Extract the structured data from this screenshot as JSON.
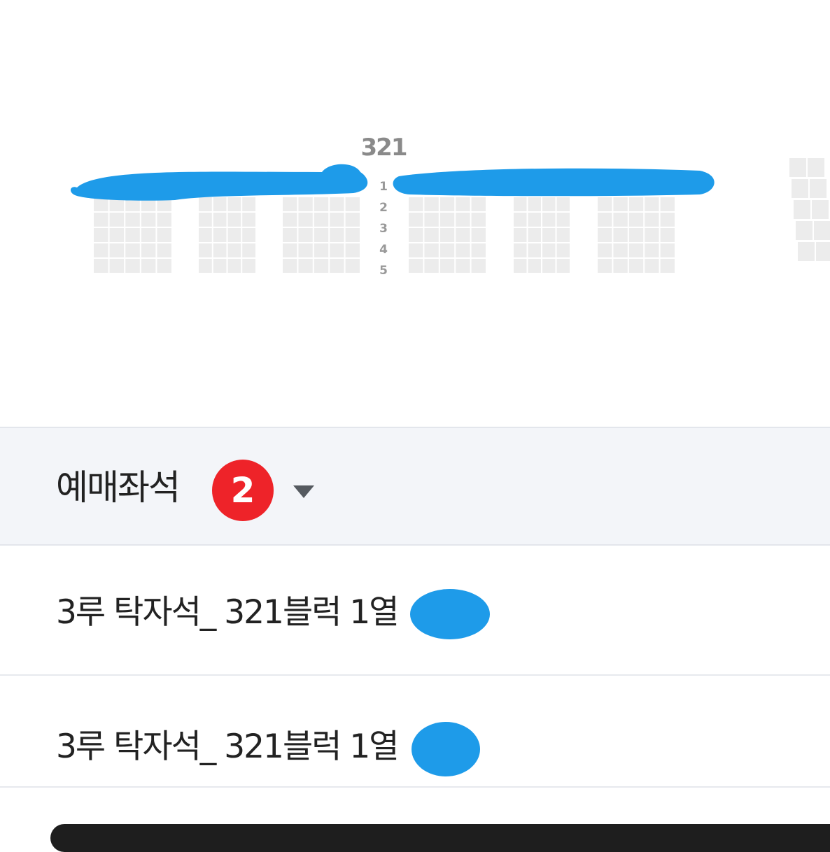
{
  "seat_map": {
    "block_label": "321",
    "row_numbers": [
      "1",
      "2",
      "3",
      "4",
      "5"
    ],
    "redaction_color": "#1e9be9",
    "seat_color": "#ececec"
  },
  "booking_panel": {
    "title": "예매좌석",
    "count": "2",
    "caret_icon": "caret-down-icon",
    "badge_color": "#ee2329"
  },
  "seats": [
    {
      "label": "3루 탁자석_ 321블럭 1열"
    },
    {
      "label": "3루 탁자석_ 321블럭 1열"
    }
  ]
}
